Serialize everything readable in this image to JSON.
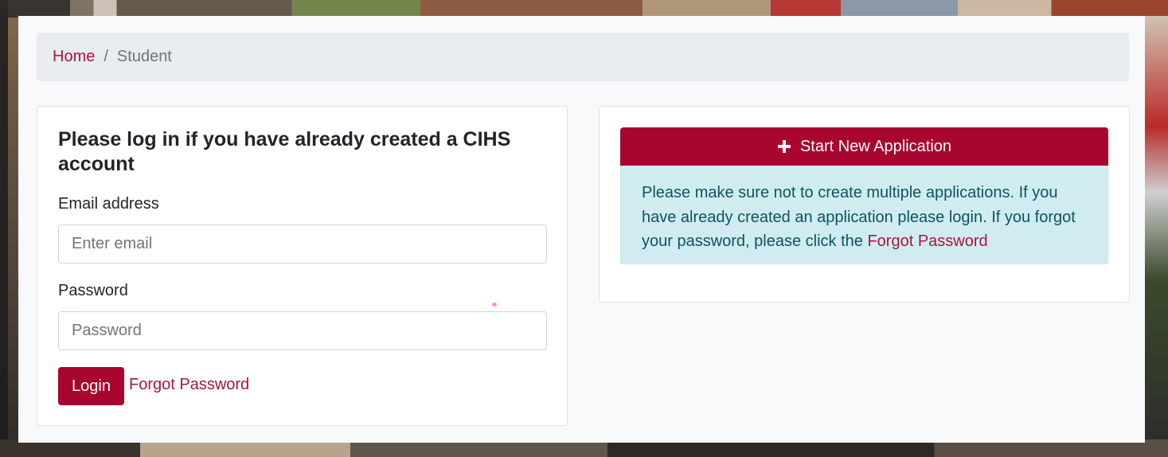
{
  "breadcrumb": {
    "home_label": "Home",
    "separator": "/",
    "current_label": "Student"
  },
  "login": {
    "title": "Please log in if you have already created a CIHS account",
    "email_label": "Email address",
    "email_placeholder": "Enter email",
    "email_value": "",
    "password_label": "Password",
    "password_placeholder": "Password",
    "password_value": "",
    "login_button": "Login",
    "forgot_link": "Forgot Password"
  },
  "application": {
    "start_button": "Start New Application",
    "start_icon": "plus-icon",
    "notice_text": "Please make sure not to create multiple applications. If you have already created an application please login. If you forgot your password, please click the ",
    "notice_link": "Forgot Password"
  },
  "colors": {
    "brand": "#a8062f",
    "link": "#a6173f",
    "alert_bg": "#d1ecf1",
    "alert_text": "#0c5460"
  }
}
